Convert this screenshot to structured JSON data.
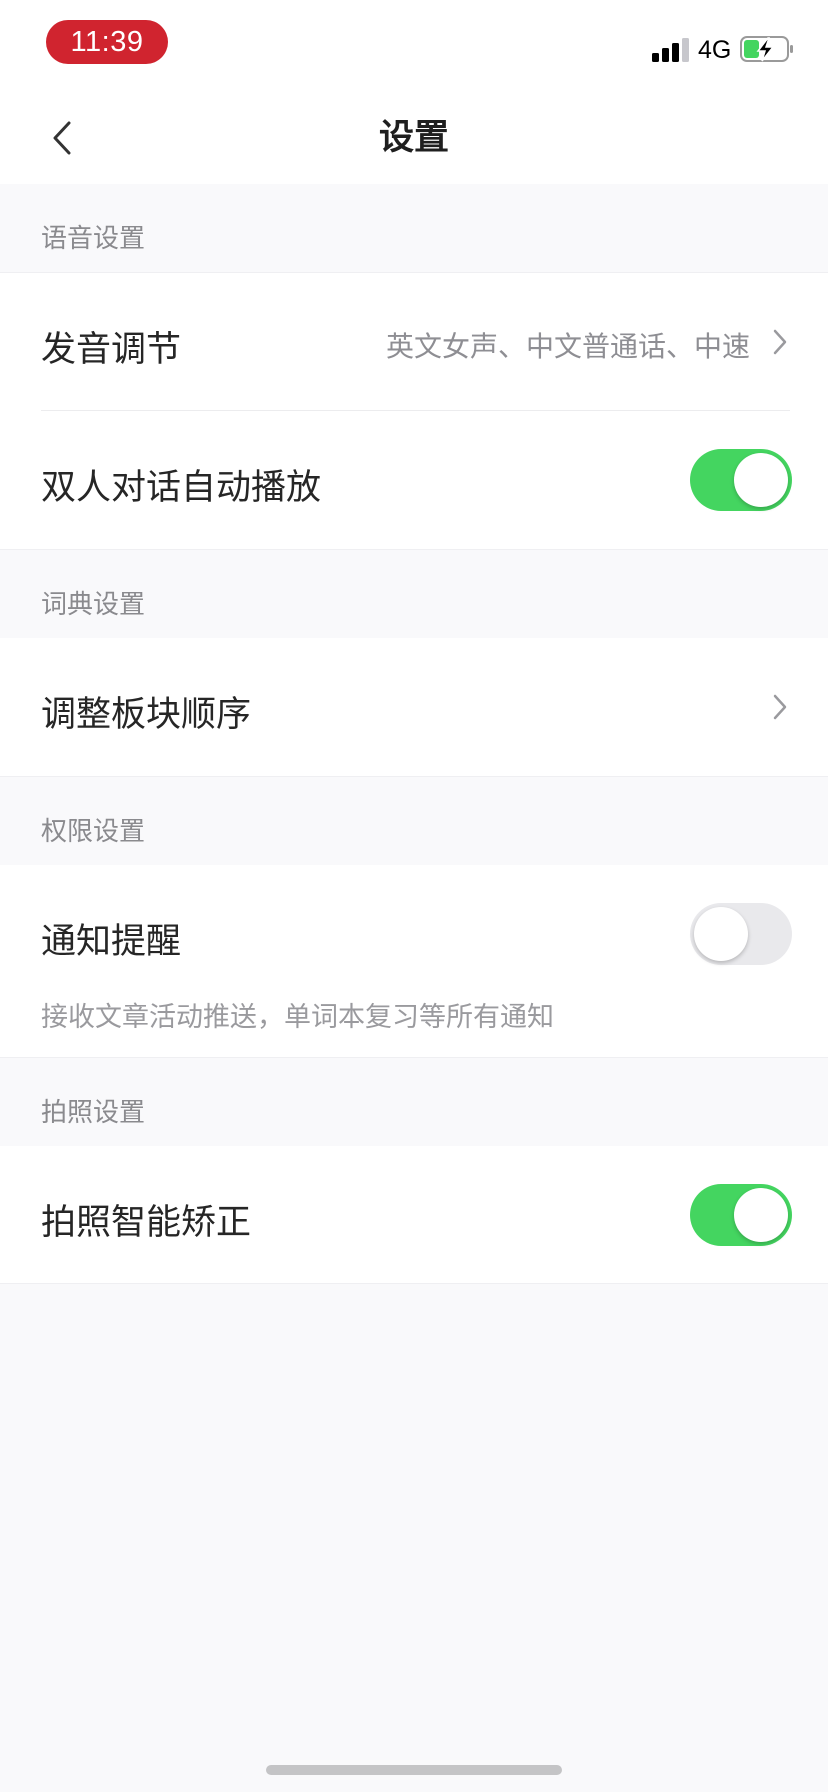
{
  "status_bar": {
    "time": "11:39",
    "network": "4G",
    "icons": [
      "signal-icon",
      "battery-charging-icon"
    ],
    "battery_fill_color": "#44d560",
    "time_pill_color": "#d0242f"
  },
  "nav": {
    "title": "设置",
    "back_icon": "chevron-left-icon"
  },
  "sections": {
    "voice": {
      "header": "语音设置",
      "pronunciation": {
        "label": "发音调节",
        "value": "英文女声、中文普通话、中速"
      },
      "dialogue_autoplay": {
        "label": "双人对话自动播放",
        "enabled": true
      }
    },
    "dictionary": {
      "header": "词典设置",
      "reorder": {
        "label": "调整板块顺序"
      }
    },
    "permissions": {
      "header": "权限设置",
      "notifications": {
        "label": "通知提醒",
        "enabled": false,
        "description": "接收文章活动推送，单词本复习等所有通知"
      }
    },
    "camera": {
      "header": "拍照设置",
      "smart_correction": {
        "label": "拍照智能矫正",
        "enabled": true
      }
    }
  },
  "colors": {
    "toggle_on": "#44d560",
    "toggle_off": "#e9e9ec",
    "background": "#f9f9fb"
  }
}
